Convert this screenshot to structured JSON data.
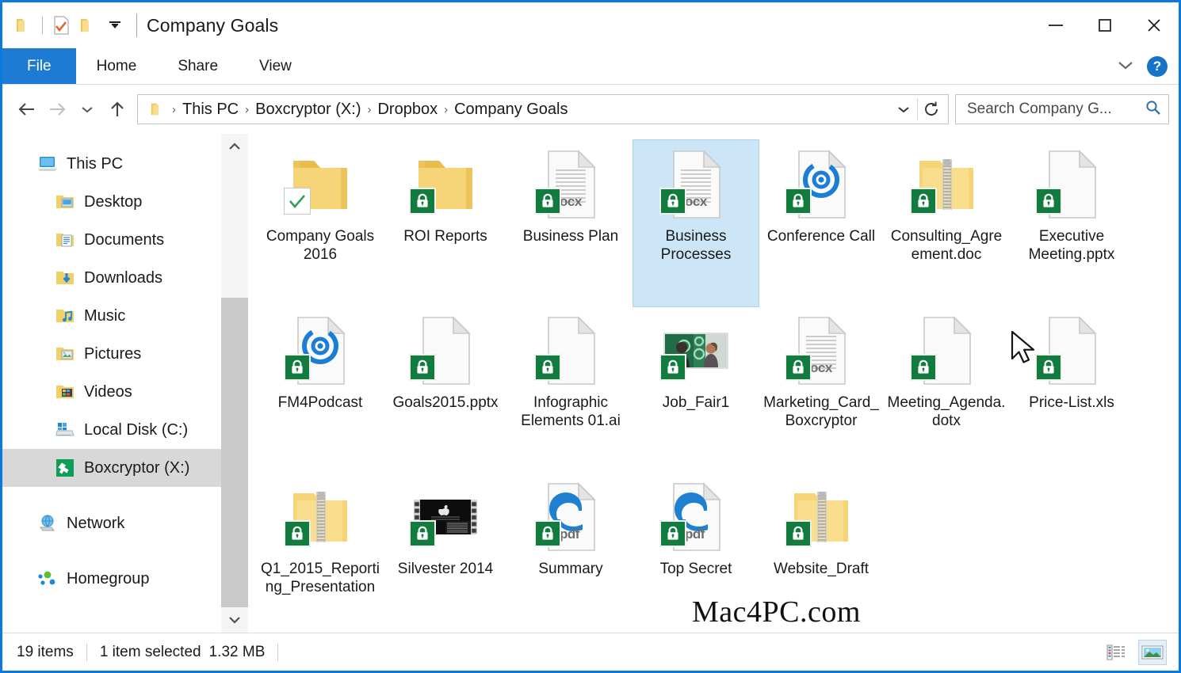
{
  "window": {
    "title": "Company Goals",
    "controls": {
      "minimize": "minimize-icon",
      "maximize": "maximize-icon",
      "close": "close-icon"
    },
    "quick_access": [
      "folder-icon",
      "properties-checked-icon",
      "new-folder-icon",
      "chevron-down-icon"
    ]
  },
  "ribbon": {
    "tabs": [
      {
        "label": "File",
        "active": true
      },
      {
        "label": "Home",
        "active": false
      },
      {
        "label": "Share",
        "active": false
      },
      {
        "label": "View",
        "active": false
      }
    ],
    "collapse_icon": "chevron-down-icon",
    "help_label": "?"
  },
  "address": {
    "back_icon": "arrow-left-icon",
    "forward_icon": "arrow-right-icon",
    "recent_icon": "chevron-down-icon",
    "up_icon": "arrow-up-icon",
    "folder_icon": "folder-icon",
    "crumbs": [
      "This PC",
      "Boxcryptor (X:)",
      "Dropbox",
      "Company Goals"
    ],
    "separator": "›",
    "dropdown_icon": "chevron-down-icon",
    "refresh_icon": "refresh-icon"
  },
  "search": {
    "placeholder": "Search Company G...",
    "value": "",
    "icon": "search-icon"
  },
  "sidebar": {
    "items": [
      {
        "label": "This PC",
        "icon": "this-pc-icon",
        "level": "root",
        "selected": false
      },
      {
        "label": "Desktop",
        "icon": "desktop-folder-icon",
        "level": "child",
        "selected": false
      },
      {
        "label": "Documents",
        "icon": "documents-folder-icon",
        "level": "child",
        "selected": false
      },
      {
        "label": "Downloads",
        "icon": "downloads-folder-icon",
        "level": "child",
        "selected": false
      },
      {
        "label": "Music",
        "icon": "music-folder-icon",
        "level": "child",
        "selected": false
      },
      {
        "label": "Pictures",
        "icon": "pictures-folder-icon",
        "level": "child",
        "selected": false
      },
      {
        "label": "Videos",
        "icon": "videos-folder-icon",
        "level": "child",
        "selected": false
      },
      {
        "label": "Local Disk (C:)",
        "icon": "local-disk-icon",
        "level": "child",
        "selected": false
      },
      {
        "label": "Boxcryptor (X:)",
        "icon": "boxcryptor-drive-icon",
        "level": "child",
        "selected": true
      },
      {
        "label": "Network",
        "icon": "network-icon",
        "level": "root",
        "selected": false,
        "gap_before": true
      },
      {
        "label": "Homegroup",
        "icon": "homegroup-icon",
        "level": "root",
        "selected": false,
        "gap_before": true
      }
    ],
    "scrollbar": {
      "up_icon": "chevron-up-icon",
      "down_icon": "chevron-down-icon"
    }
  },
  "files": [
    {
      "name": "Company Goals 2016",
      "icon": "folder-icon",
      "badge": "check",
      "selected": false
    },
    {
      "name": "ROI Reports",
      "icon": "folder-icon",
      "badge": "lock",
      "selected": false
    },
    {
      "name": "Business Plan",
      "icon": "word-doc-icon",
      "ext": "ocx",
      "badge": "lock",
      "selected": false
    },
    {
      "name": "Business Processes",
      "icon": "word-doc-icon",
      "ext": "ocx",
      "badge": "lock",
      "selected": true
    },
    {
      "name": "Conference Call",
      "icon": "media-disc-doc-icon",
      "badge": "lock",
      "selected": false
    },
    {
      "name": "Consulting_Agreement.doc",
      "icon": "zip-folder-icon",
      "badge": "lock",
      "selected": false
    },
    {
      "name": "Executive Meeting.pptx",
      "icon": "blank-doc-icon",
      "badge": "lock",
      "selected": false
    },
    {
      "name": "FM4Podcast",
      "icon": "media-disc-doc-icon",
      "badge": "lock",
      "selected": false
    },
    {
      "name": "Goals2015.pptx",
      "icon": "blank-doc-icon",
      "badge": "lock",
      "selected": false
    },
    {
      "name": "Infographic Elements 01.ai",
      "icon": "blank-doc-icon",
      "badge": "lock",
      "selected": false
    },
    {
      "name": "Job_Fair1",
      "icon": "photo-thumbnail-icon",
      "badge": "lock",
      "selected": false
    },
    {
      "name": "Marketing_Card_Boxcryptor",
      "icon": "word-doc-icon",
      "ext": "ocx",
      "badge": "lock",
      "selected": false
    },
    {
      "name": "Meeting_Agenda.dotx",
      "icon": "blank-doc-icon",
      "badge": "lock",
      "selected": false
    },
    {
      "name": "Price-List.xls",
      "icon": "blank-doc-icon",
      "badge": "lock",
      "selected": false
    },
    {
      "name": "Q1_2015_Reporting_Presentation",
      "icon": "zip-folder-icon",
      "badge": "lock",
      "selected": false
    },
    {
      "name": "Silvester 2014",
      "icon": "video-thumbnail-icon",
      "badge": "lock",
      "selected": false
    },
    {
      "name": "Summary",
      "icon": "pdf-edge-icon",
      "ext": "pdf",
      "badge": "lock",
      "selected": false
    },
    {
      "name": "Top Secret",
      "icon": "pdf-edge-icon",
      "ext": "pdf",
      "badge": "lock",
      "selected": false
    },
    {
      "name": "Website_Draft",
      "icon": "zip-folder-icon",
      "badge": "lock",
      "selected": false
    }
  ],
  "watermark": "Mac4PC.com",
  "status": {
    "item_count": "19 items",
    "selection": "1 item selected",
    "size": "1.32 MB",
    "views": [
      {
        "name": "details-view-button",
        "active": false
      },
      {
        "name": "large-icons-view-button",
        "active": true
      }
    ]
  },
  "colors": {
    "accent": "#1e7bd4",
    "window_border": "#0a7ae0",
    "selection": "#cce5f7",
    "sidebar_selection": "#d8d8d8",
    "lock_badge": "#127c3f",
    "folder": "#f3cf68",
    "edge_blue": "#1f7fd0"
  }
}
